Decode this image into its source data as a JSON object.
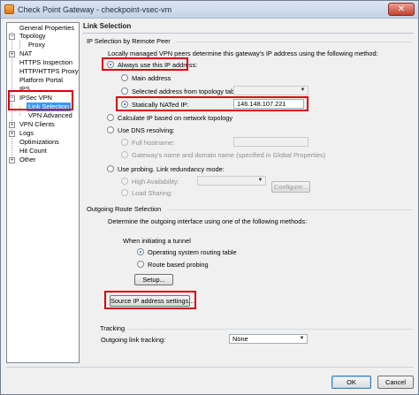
{
  "window": {
    "title": "Check Point Gateway - checkpoint-vsec-vm",
    "close_symbol": "✕"
  },
  "tree": {
    "items": [
      {
        "label": "General Properties"
      },
      {
        "label": "Topology",
        "expander": "−"
      },
      {
        "label": "Proxy"
      },
      {
        "label": "NAT",
        "expander": "+"
      },
      {
        "label": "HTTPS Inspection"
      },
      {
        "label": "HTTP/HTTPS Proxy"
      },
      {
        "label": "Platform Portal"
      },
      {
        "label": "IPS"
      },
      {
        "label": "IPSec VPN",
        "expander": "−"
      },
      {
        "label": "Link Selection",
        "selected": true
      },
      {
        "label": "VPN Advanced"
      },
      {
        "label": "VPN Clients",
        "expander": "+"
      },
      {
        "label": "Logs",
        "expander": "+"
      },
      {
        "label": "Optimizations"
      },
      {
        "label": "Hit Count"
      },
      {
        "label": "Other",
        "expander": "+"
      }
    ]
  },
  "panel": {
    "title": "Link Selection",
    "ip_selection": {
      "group_title": "IP Selection by Remote Peer",
      "description": "Locally managed VPN peers determine this gateway's IP address using the following method:",
      "always_use": "Always use this IP address:",
      "main_address": "Main address",
      "selected_from_topology": "Selected address from topology table:",
      "statically_nated": "Statically NATed IP:",
      "nated_ip_value": "146.148.107.221",
      "calculate": "Calculate IP based on network topology",
      "use_dns": "Use DNS resolving:",
      "full_hostname": "Full hostname:",
      "gateway_name_domain": "Gateway's name and domain name (specified in Global Properties)",
      "use_probing": "Use probing. Link redundancy mode:",
      "high_availability": "High Availability:",
      "load_sharing": "Load Sharing:",
      "configure_label": "Configure..."
    },
    "outgoing": {
      "group_title": "Outgoing Route Selection",
      "description": "Determine the outgoing interface using one of the following methods:",
      "when_initiating": "When initiating a tunnel",
      "os_routing": "Operating system routing table",
      "route_based": "Route based probing",
      "setup_label": "Setup...",
      "source_ip_label": "Source IP address settings..."
    },
    "tracking": {
      "group_title": "Tracking",
      "outgoing_link_label": "Outgoing link tracking:",
      "outgoing_link_value": "None"
    }
  },
  "footer": {
    "ok": "OK",
    "cancel": "Cancel"
  },
  "colors": {
    "highlight_red": "#d9000f",
    "selection_blue": "#3399ff"
  }
}
